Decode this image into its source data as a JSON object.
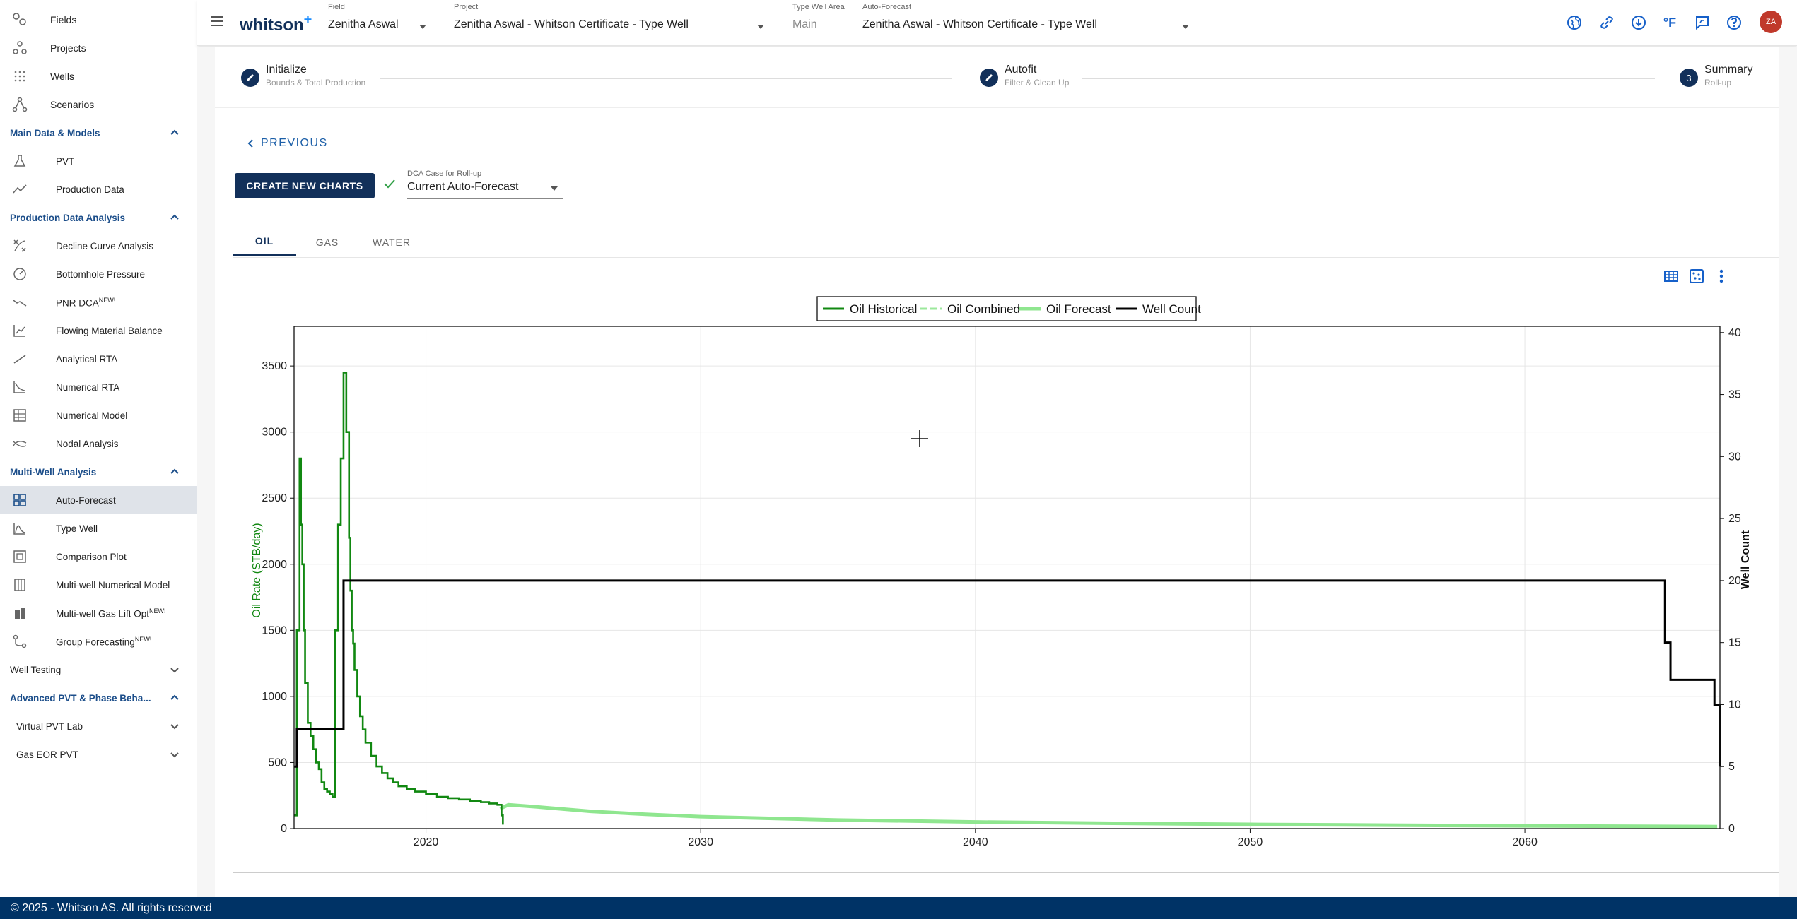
{
  "sidebar": {
    "top_items": [
      {
        "label": "Fields",
        "icon": "fields-icon"
      },
      {
        "label": "Projects",
        "icon": "projects-icon"
      },
      {
        "label": "Wells",
        "icon": "wells-icon"
      },
      {
        "label": "Scenarios",
        "icon": "scenarios-icon"
      }
    ],
    "sections": {
      "main_data": {
        "title": "Main Data & Models",
        "items": [
          "PVT",
          "Production Data"
        ]
      },
      "pda": {
        "title": "Production Data Analysis",
        "items": [
          "Decline Curve Analysis",
          "Bottomhole Pressure",
          "PNR DCA",
          "Flowing Material Balance",
          "Analytical RTA",
          "Numerical RTA",
          "Numerical Model",
          "Nodal Analysis"
        ]
      },
      "mwa": {
        "title": "Multi-Well Analysis",
        "items": [
          "Auto-Forecast",
          "Type Well",
          "Comparison Plot",
          "Multi-well Numerical Model",
          "Multi-well Gas Lift Opt",
          "Group Forecasting"
        ]
      },
      "well_testing": {
        "title": "Well Testing"
      },
      "adv_pvt": {
        "title": "Advanced PVT & Phase Beha..."
      },
      "vpl": {
        "title": "Virtual PVT Lab"
      },
      "gas_eor": {
        "title": "Gas EOR PVT"
      }
    },
    "new_badge": "NEW!",
    "active_item": "Auto-Forecast"
  },
  "header": {
    "logo": "whitson",
    "logo_plus": "+",
    "field_caption": "Field",
    "field_value": "Zenitha Aswal",
    "project_caption": "Project",
    "project_value": "Zenitha Aswal - Whitson Certificate - Type Well",
    "twa_caption": "Type Well Area",
    "twa_value": "Main",
    "af_caption": "Auto-Forecast",
    "af_value": "Zenitha Aswal - Whitson Certificate - Type Well",
    "temp_unit": "°F",
    "avatar": "ZA",
    "accent": "#1660c9"
  },
  "stepper": {
    "steps": [
      {
        "title": "Initialize",
        "subtitle": "Bounds & Total Production"
      },
      {
        "title": "Autofit",
        "subtitle": "Filter & Clean Up"
      },
      {
        "title": "Summary",
        "subtitle": "Roll-up",
        "number": "3"
      }
    ]
  },
  "controls": {
    "previous_label": "PREVIOUS",
    "create_label": "CREATE NEW CHARTS",
    "dca_caption": "DCA Case for Roll-up",
    "dca_value": "Current Auto-Forecast"
  },
  "tabs": [
    "OIL",
    "GAS",
    "WATER"
  ],
  "active_tab": "OIL",
  "footer": {
    "text": "© 2025 - Whitson AS. All rights reserved"
  },
  "chart_data": {
    "type": "line",
    "legend": [
      "Oil Historical",
      "Oil Combined",
      "Oil Forecast",
      "Well Count"
    ],
    "legend_position": "top-center",
    "ylabel": "Oil Rate (STB/day)",
    "y2label": "Well Count",
    "x_ticks": [
      2020,
      2030,
      2040,
      2050,
      2060
    ],
    "y_ticks": [
      0,
      500,
      1000,
      1500,
      2000,
      2500,
      3000,
      3500
    ],
    "y2_ticks": [
      0,
      5,
      10,
      15,
      20,
      25,
      30,
      35,
      40
    ],
    "xlim": [
      2015.2,
      2067.1
    ],
    "ylim": [
      0,
      3800
    ],
    "y2lim": [
      0,
      40.5
    ],
    "grid": true,
    "colors": {
      "historical": "#118811",
      "combined": "#9ce89c",
      "forecast": "#8fe68f",
      "well_count": "#000000"
    },
    "series": [
      {
        "name": "Oil Historical",
        "x": [
          2015.2,
          2015.3,
          2015.4,
          2015.45,
          2015.5,
          2015.55,
          2015.6,
          2015.7,
          2015.8,
          2015.9,
          2016.0,
          2016.1,
          2016.2,
          2016.3,
          2016.4,
          2016.5,
          2016.6,
          2016.7,
          2016.8,
          2016.9,
          2017.0,
          2017.1,
          2017.2,
          2017.25,
          2017.3,
          2017.35,
          2017.4,
          2017.5,
          2017.6,
          2017.7,
          2017.8,
          2018.0,
          2018.2,
          2018.4,
          2018.6,
          2018.8,
          2019.0,
          2019.3,
          2019.6,
          2020.0,
          2020.4,
          2020.8,
          2021.2,
          2021.6,
          2022.0,
          2022.3,
          2022.6,
          2022.75,
          2022.8
        ],
        "y": [
          100,
          1500,
          2800,
          2300,
          2000,
          1500,
          1100,
          800,
          700,
          600,
          500,
          450,
          350,
          300,
          280,
          260,
          240,
          1500,
          2300,
          2800,
          3450,
          3000,
          2200,
          1800,
          1500,
          1400,
          1200,
          1000,
          850,
          750,
          650,
          550,
          470,
          420,
          380,
          350,
          320,
          300,
          280,
          260,
          240,
          230,
          220,
          210,
          200,
          190,
          180,
          100,
          30
        ]
      },
      {
        "name": "Oil Forecast",
        "x": [
          2022.7,
          2023,
          2024,
          2026,
          2028,
          2030,
          2035,
          2040,
          2045,
          2050,
          2055,
          2060,
          2065,
          2067
        ],
        "y": [
          150,
          180,
          165,
          130,
          108,
          90,
          65,
          50,
          40,
          32,
          26,
          21,
          17,
          15
        ]
      },
      {
        "name": "Well Count",
        "x": [
          2015.2,
          2015.3,
          2016.8,
          2017.0,
          2017.2,
          2065.0,
          2065.1,
          2065.3,
          2066.8,
          2066.9,
          2067.1
        ],
        "y": [
          5,
          8,
          8,
          20,
          20,
          20,
          15,
          12,
          12,
          10,
          5
        ]
      }
    ]
  }
}
